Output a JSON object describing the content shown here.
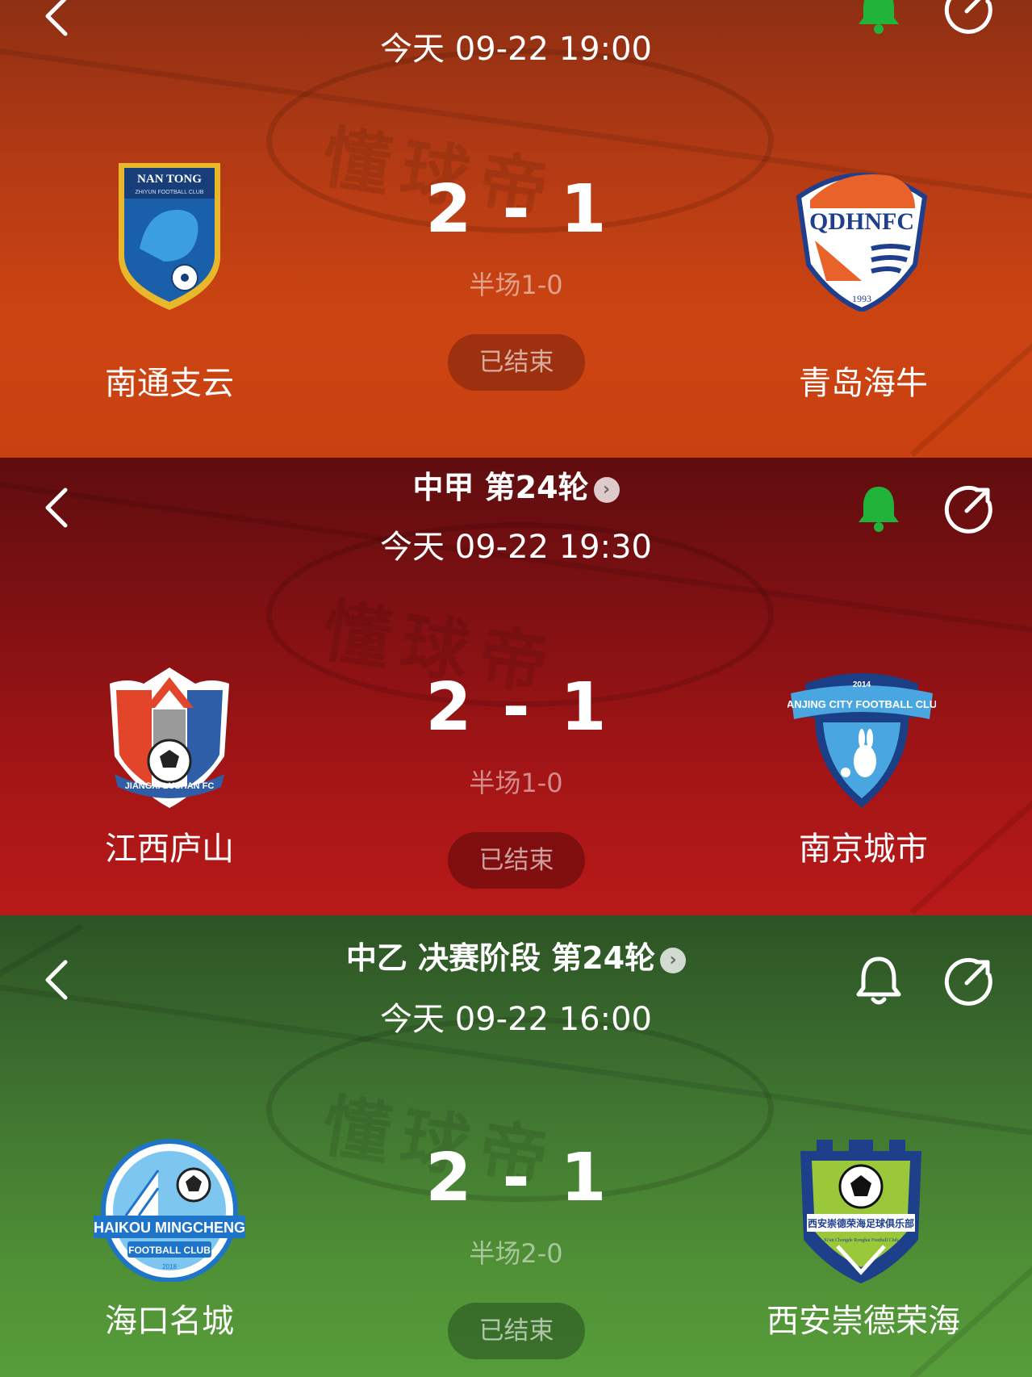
{
  "matches": [
    {
      "league": "",
      "datetime": "今天 09-22 19:00",
      "score_home": "2",
      "score_sep": "-",
      "score_away": "1",
      "halftime": "半场1-0",
      "status": "已结束",
      "bell_active": true,
      "home": {
        "name": "南通支云",
        "logo_text": "NAN TONG",
        "logo_sub": "ZHIYUN FOOTBALL CLUB"
      },
      "away": {
        "name": "青岛海牛",
        "logo_text": "QDHNFC",
        "logo_sub": "1993"
      },
      "watermark": "懂球帝"
    },
    {
      "league": "中甲  第24轮",
      "datetime": "今天 09-22 19:30",
      "score_home": "2",
      "score_sep": "-",
      "score_away": "1",
      "halftime": "半场1-0",
      "status": "已结束",
      "bell_active": true,
      "home": {
        "name": "江西庐山",
        "logo_text": "JIANGXI LUSHAN FC"
      },
      "away": {
        "name": "南京城市",
        "logo_text": "NANJING CITY FOOTBALL CLUB",
        "logo_sub": "2014"
      },
      "watermark": "懂球帝"
    },
    {
      "league": "中乙 决赛阶段 第24轮",
      "datetime": "今天 09-22 16:00",
      "score_home": "2",
      "score_sep": "-",
      "score_away": "1",
      "halftime": "半场2-0",
      "status": "已结束",
      "bell_active": false,
      "home": {
        "name": "海口名城",
        "logo_text": "HAIKOU MINGCHENG",
        "logo_sub": "FOOTBALL CLUB",
        "logo_year": "2018"
      },
      "away": {
        "name": "西安崇德荣海",
        "logo_text": "西安崇德荣海足球俱乐部",
        "logo_sub": "Xi'an Chongde Ronghai Football Club"
      },
      "watermark": "懂球帝"
    }
  ],
  "colors": {
    "bell_active": "#22b33a",
    "panel1": "#c4410f",
    "panel2": "#a51516",
    "panel3": "#4f8f35"
  },
  "icons": {
    "back": "chevron-left-icon",
    "bell": "bell-icon",
    "share": "share-icon",
    "league_link": "chevron-right-circle-icon"
  }
}
